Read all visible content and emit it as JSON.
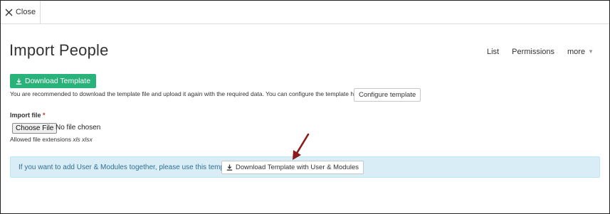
{
  "topbar": {
    "close_label": "Close"
  },
  "page": {
    "title": "Import People"
  },
  "top_links": {
    "list": "List",
    "permissions": "Permissions",
    "more": "more"
  },
  "download_template": {
    "label": "Download Template"
  },
  "help_text": "You are recommended to download the template file and upload it again with the required data. You can configure the template here:",
  "configure_template": {
    "label": "Configure template"
  },
  "import_file": {
    "label": "Import file",
    "required_mark": "*",
    "choose_button": "Choose File",
    "status": "No file chosen",
    "allowed_prefix": "Allowed file extensions",
    "allowed_extensions": "xls xlsx"
  },
  "info": {
    "text": "If you want to add User & Modules together, please use this template",
    "button_label": "Download Template with User & Modules"
  },
  "colors": {
    "accent_green": "#2ab27b",
    "info_bg": "#d9edf7",
    "info_text": "#31708f",
    "annotation_arrow": "#8b1a1a",
    "required": "#c9302c"
  },
  "icons": [
    "close-icon",
    "download-icon",
    "chevron-down-icon",
    "annotation-arrow"
  ]
}
